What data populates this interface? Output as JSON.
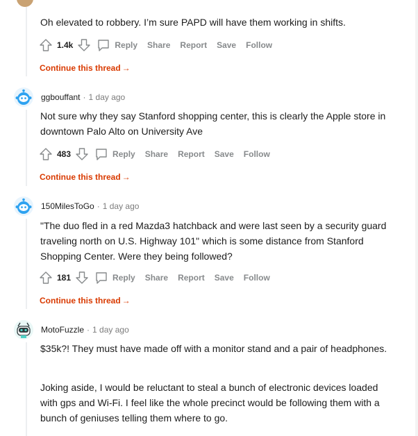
{
  "comments": [
    {
      "username": "",
      "time": "",
      "paragraphs": [
        "Oh elevated to robbery. I’m sure PAPD will have them working in shifts."
      ],
      "score": "1.4k",
      "continue": "Continue this thread"
    },
    {
      "username": "ggbouffant",
      "time": "1 day ago",
      "paragraphs": [
        "Not sure why they say Stanford shopping center, this is clearly the Apple store in downtown Palo Alto on University Ave"
      ],
      "score": "483",
      "continue": "Continue this thread"
    },
    {
      "username": "150MilesToGo",
      "time": "1 day ago",
      "paragraphs": [
        "\"The duo fled in a red Mazda3 hatchback and were last seen by a security guard traveling north on U.S. Highway 101\" which is some distance from Stanford Shopping Center. Were they being followed?"
      ],
      "score": "181",
      "continue": "Continue this thread"
    },
    {
      "username": "MotoFuzzle",
      "time": "1 day ago",
      "paragraphs": [
        "$35k?! They must have made off with a monitor stand and a pair of headphones.",
        "Joking aside, I would be reluctant to steal a bunch of electronic devices loaded with gps and Wi-Fi. I feel like the whole precinct would be following them with a bunch of geniuses telling them where to go."
      ]
    }
  ],
  "actions": {
    "reply": "Reply",
    "share": "Share",
    "report": "Report",
    "save": "Save",
    "follow": "Follow"
  },
  "separator": "·",
  "continue_arrow": "→",
  "icons": {
    "upvote": "upvote-arrow-icon",
    "downvote": "downvote-arrow-icon",
    "reply": "speech-bubble-icon",
    "avatar": "snoo-avatar-icon"
  },
  "colors": {
    "continue_link": "#d93a00",
    "action_text": "#878a8c",
    "avatar_blue": "#2ea2f0"
  }
}
